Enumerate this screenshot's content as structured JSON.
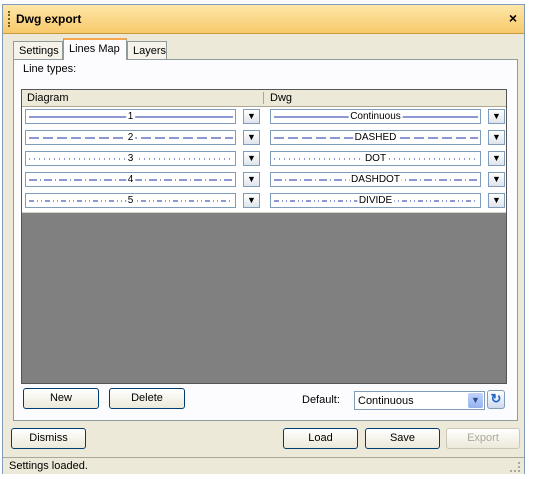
{
  "window": {
    "title": "Dwg export",
    "close_glyph": "×"
  },
  "tabs": [
    {
      "label": "Settings",
      "active": false
    },
    {
      "label": "Lines Map",
      "active": true
    },
    {
      "label": "Layers",
      "active": false
    }
  ],
  "panel": {
    "section_label": "Line types:"
  },
  "grid": {
    "columns": [
      "Diagram",
      "Dwg"
    ],
    "rows": [
      {
        "diagram_label": "1",
        "dwg_label": "Continuous"
      },
      {
        "diagram_label": "2",
        "dwg_label": "DASHED"
      },
      {
        "diagram_label": "3",
        "dwg_label": "DOT"
      },
      {
        "diagram_label": "4",
        "dwg_label": "DASHDOT"
      },
      {
        "diagram_label": "5",
        "dwg_label": "DIVIDE"
      }
    ]
  },
  "buttons": {
    "new": "New",
    "delete": "Delete",
    "dismiss": "Dismiss",
    "load": "Load",
    "save": "Save",
    "export": "Export"
  },
  "default": {
    "label": "Default:",
    "value": "Continuous"
  },
  "status": {
    "text": "Settings loaded."
  },
  "colors": {
    "title_bar": "#f7c96b",
    "line_stroke": "#1a2fa8",
    "grid_bg": "#808080"
  },
  "icons": {
    "dropdown": "chevron-down-icon",
    "refresh": "refresh-icon",
    "close": "close-icon"
  }
}
